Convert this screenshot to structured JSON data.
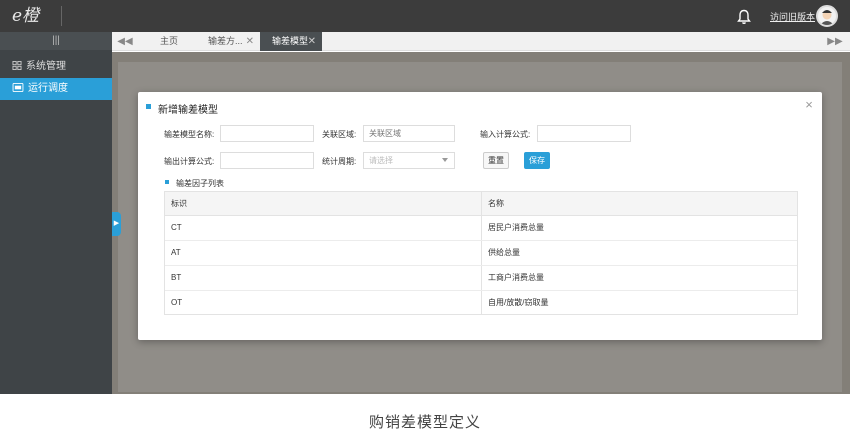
{
  "header": {
    "logo": "e橙",
    "old_version_link": "访问旧版本"
  },
  "sidebar": {
    "collapse_glyph": "|||",
    "items": [
      {
        "label": "系统管理",
        "icon": "grid-icon"
      },
      {
        "label": "运行调度",
        "icon": "dispatch-icon",
        "active": true
      }
    ]
  },
  "tabs": {
    "prev": "◀◀",
    "next": "▶▶",
    "items": [
      {
        "label": "主页"
      },
      {
        "label": "输差方...",
        "close": "✕"
      },
      {
        "label": "输差模型",
        "close": "✕",
        "active": true
      }
    ]
  },
  "modal": {
    "title": "新增输差模型",
    "close": "×",
    "form": {
      "model_name_label": "输差模型名称:",
      "model_name_value": "",
      "region_label": "关联区域:",
      "region_placeholder": "关联区域",
      "input_formula_label": "输入计算公式:",
      "input_formula_value": "",
      "output_formula_label": "输出计算公式:",
      "output_formula_value": "",
      "period_label": "统计周期:",
      "period_placeholder": "请选择"
    },
    "buttons": {
      "reset": "重置",
      "save": "保存"
    },
    "factor_list_title": "输差因子列表",
    "table": {
      "columns": [
        "标识",
        "名称"
      ],
      "rows": [
        [
          "CT",
          "居民户消费总量"
        ],
        [
          "AT",
          "供给总量"
        ],
        [
          "BT",
          "工商户消费总量"
        ],
        [
          "OT",
          "自用/放散/窃取量"
        ]
      ]
    }
  },
  "caption": "购销差模型定义",
  "colors": {
    "accent": "#2a9fd8",
    "topbar": "#3c3c3c",
    "sidebar": "#3f4447"
  }
}
